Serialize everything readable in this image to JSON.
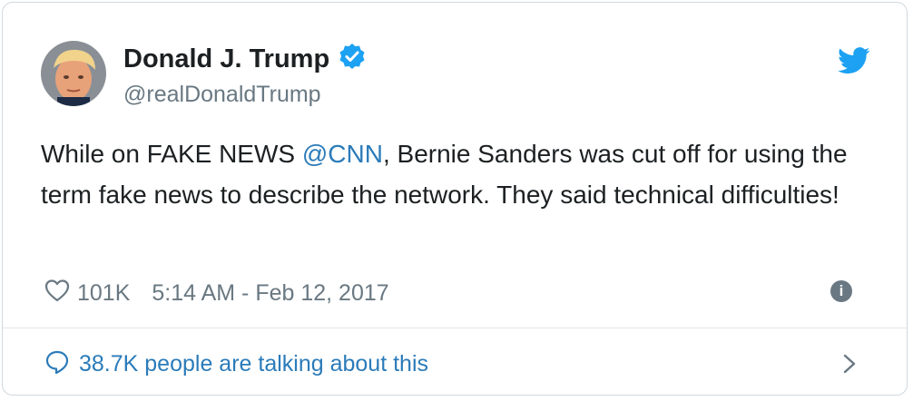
{
  "author": {
    "name": "Donald J. Trump",
    "handle": "@realDonaldTrump"
  },
  "tweet": {
    "text_before": "While on FAKE NEWS ",
    "mention": "@CNN",
    "text_after": ", Bernie Sanders was cut off for using the term fake news to describe the network. They said technical difficulties!"
  },
  "meta": {
    "likes": "101K",
    "timestamp": "5:14 AM - Feb 12, 2017"
  },
  "footer": {
    "label": "38.7K people are talking about this"
  },
  "icons": [
    "verified-badge-icon",
    "twitter-bird-icon",
    "heart-icon",
    "info-icon",
    "speech-bubble-icon",
    "chevron-right-icon"
  ],
  "colors": {
    "link": "#2b7bb9",
    "muted": "#697882",
    "twitter_blue": "#1da1f2",
    "text": "#1c2022"
  }
}
